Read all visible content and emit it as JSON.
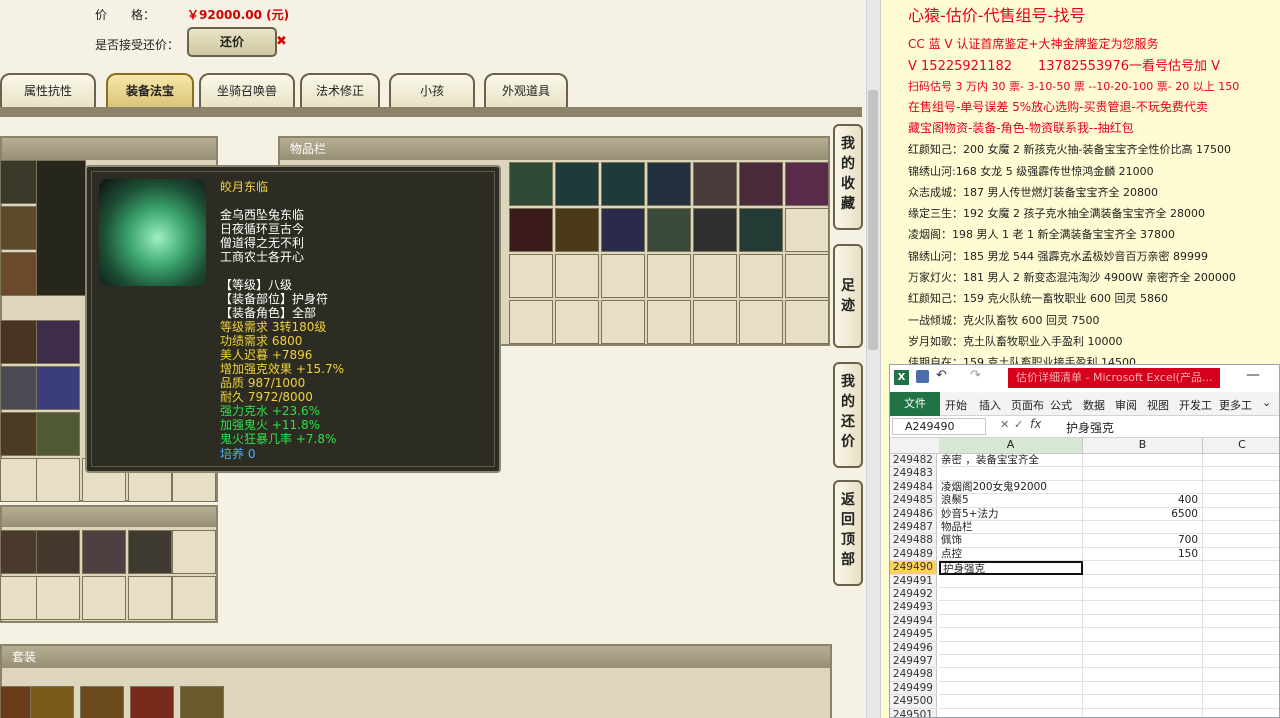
{
  "trade": {
    "price_label": "价　　格：",
    "price_value": "￥92000.00 (元)",
    "haggle_label": "是否接受还价：",
    "haggle_button": "还价"
  },
  "tabs": [
    "属性抗性",
    "装备法宝",
    "坐骑召唤兽",
    "法术修正",
    "小孩",
    "外观道具"
  ],
  "inventory_header": "物品栏",
  "suit_header": "套装",
  "side_buttons": [
    "我的收藏",
    "足迹",
    "我的还价",
    "返回顶部"
  ],
  "tooltip": {
    "name": "皎月东临",
    "desc": [
      "金乌西坠兔东临",
      "日夜循环亘古今",
      "僧道得之无不利",
      "工商农士各开心"
    ],
    "stats_white": [
      "【等级】八级",
      "【装备部位】护身符",
      "【装备角色】全部"
    ],
    "stats_yellow": [
      "等级需求 3转180级",
      "功绩需求 6800",
      "美人迟暮 +7896",
      "增加强克效果 +15.7%",
      "品质 987/1000",
      "耐久 7972/8000"
    ],
    "stats_green": [
      "强力克水 +23.6%",
      "加强鬼火 +11.8%",
      "鬼火狂暴几率 +7.8%"
    ],
    "stats_blue": [
      "培养 0"
    ]
  },
  "ads": {
    "title": "心猿-估价-代售组号-找号",
    "lines_red": [
      "CC 蓝 V 认证首席鉴定+大神金牌鉴定为您服务",
      "V 15225921182　　13782553976一看号估号加 V",
      "扫码估号 3 万内 30 票- 3-10-50 票  --10-20-100 票- 20 以上 150",
      "在售组号-单号误差 5%放心选购-买贵管退-不玩免费代卖",
      "藏宝阁物资-装备-角色-物资联系我--抽红包"
    ],
    "lines_black": [
      "红颜知己：200 女魔 2 新孩克火抽-装备宝宝齐全性价比高 17500",
      "锦绣山河:168 女龙 5 级强霹传世惊鸿金麟 21000",
      "众志成城：187 男人传世燃灯装备宝宝齐全 20800",
      "缘定三生：192 女魔 2 孩子克水抽全满装备宝宝齐全 28000",
      "凌烟阁：198 男人 1 老 1 新全满装备宝宝齐全 37800",
      "锦绣山河：185 男龙 544 强霹克水孟极妙音百万亲密 89999",
      "万家灯火：181 男人 2 新变态混沌淘沙 4900W 亲密齐全 200000",
      "红颜知己：159 克火队统一畜牧职业 600 回灵 5860",
      "一战倾城：克火队畜牧 600 回灵 7500",
      "岁月如歌：克土队畜牧职业入手盈利 10000",
      "佳期自在：159 克土队畜职业接手盈利 14500"
    ]
  },
  "excel": {
    "title": "估价详细清单 - Microsoft Excel(产品...",
    "menus": [
      "文件",
      "开始",
      "插入",
      "页面布",
      "公式",
      "数据",
      "审阅",
      "视图",
      "开发工",
      "更多工"
    ],
    "name_box": "A249490",
    "formula": "护身强克",
    "columns": [
      "A",
      "B",
      "C"
    ],
    "rows": [
      {
        "num": "249482",
        "a": "亲密  ，装备宝宝齐全",
        "b": ""
      },
      {
        "num": "249483",
        "a": "",
        "b": ""
      },
      {
        "num": "249484",
        "a": "凌烟阁200女鬼92000",
        "b": ""
      },
      {
        "num": "249485",
        "a": "浪鬃5",
        "b": "400"
      },
      {
        "num": "249486",
        "a": "妙音5+法力",
        "b": "6500"
      },
      {
        "num": "249487",
        "a": "物品栏",
        "b": ""
      },
      {
        "num": "249488",
        "a": "佩饰",
        "b": "700"
      },
      {
        "num": "249489",
        "a": "点控",
        "b": "150"
      },
      {
        "num": "249490",
        "a": "护身强克",
        "b": ""
      },
      {
        "num": "249491",
        "a": "",
        "b": ""
      },
      {
        "num": "249492",
        "a": "",
        "b": ""
      },
      {
        "num": "249493",
        "a": "",
        "b": ""
      },
      {
        "num": "249494",
        "a": "",
        "b": ""
      },
      {
        "num": "249495",
        "a": "",
        "b": ""
      },
      {
        "num": "249496",
        "a": "",
        "b": ""
      },
      {
        "num": "249497",
        "a": "",
        "b": ""
      },
      {
        "num": "249498",
        "a": "",
        "b": ""
      },
      {
        "num": "249499",
        "a": "",
        "b": ""
      },
      {
        "num": "249500",
        "a": "",
        "b": ""
      },
      {
        "num": "249501",
        "a": "",
        "b": ""
      }
    ]
  },
  "colors": {
    "price": "#d40000",
    "ad_red": "#e8001c",
    "tooltip_yellow": "#f0d23c",
    "tooltip_green": "#2fe04a",
    "tooltip_blue": "#4fb0ff",
    "excel_green": "#217346"
  }
}
